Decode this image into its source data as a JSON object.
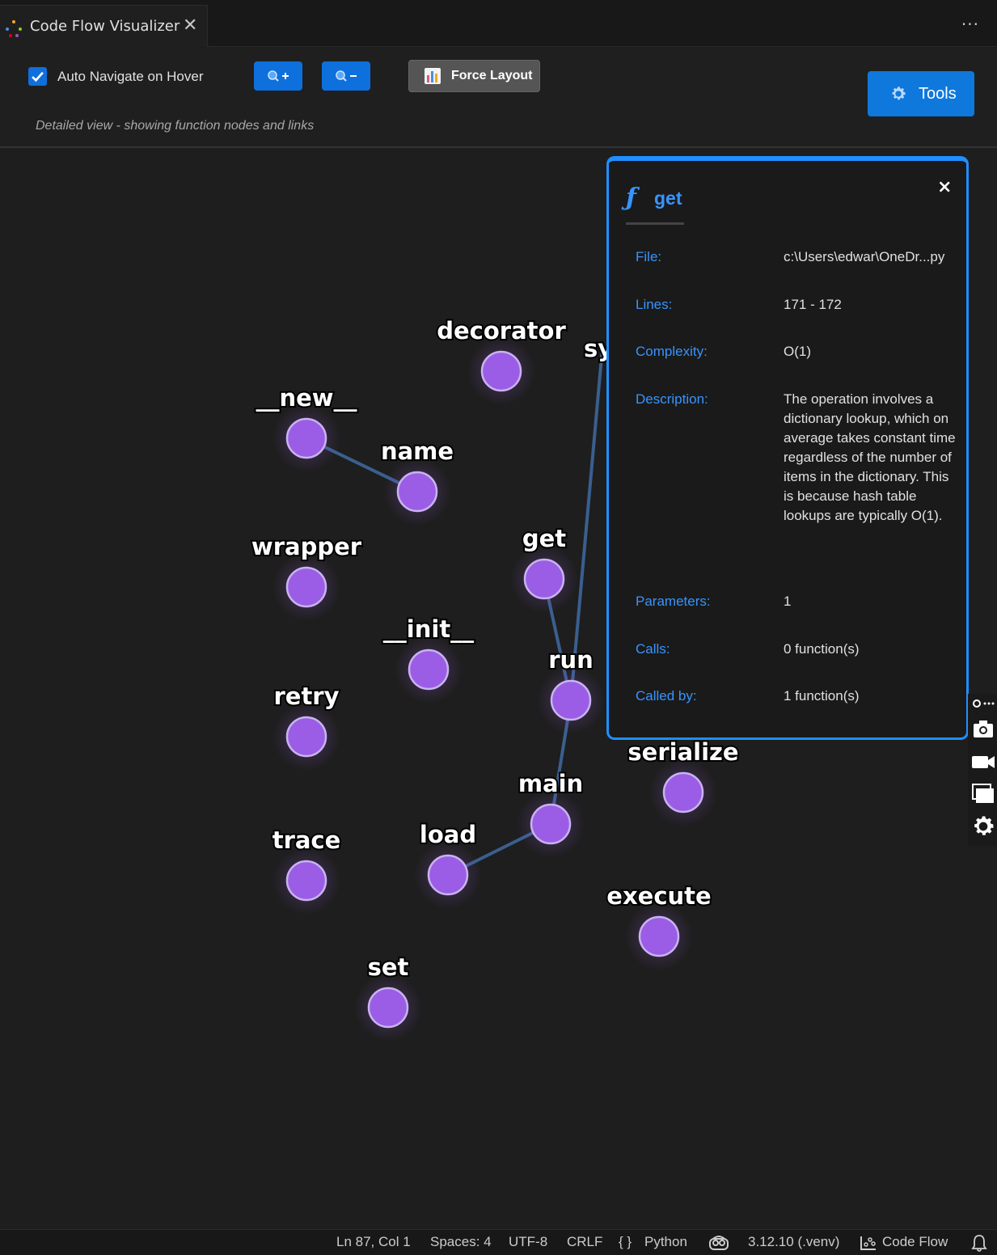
{
  "tab": {
    "title": "Code Flow Visualizer",
    "close_glyph": "✕",
    "more_glyph": "···"
  },
  "toolbar": {
    "auto_navigate_label": "Auto Navigate on Hover",
    "auto_navigate_checked": true,
    "zoom_in_label": "🔍+",
    "zoom_out_label": "🔍−",
    "force_layout_label": "Force Layout",
    "tools_label": "Tools",
    "subtitle": "Detailed view - showing function nodes and links"
  },
  "graph": {
    "nodes": [
      "decorator",
      "sy",
      "__new__",
      "name",
      "wrapper",
      "get",
      "__init__",
      "run",
      "retry",
      "serialize",
      "main",
      "trace",
      "load",
      "execute",
      "set"
    ],
    "links": [
      [
        "__new__",
        "name"
      ],
      [
        "get",
        "run"
      ],
      [
        "run",
        "main"
      ],
      [
        "main",
        "load"
      ],
      [
        "run",
        "sy"
      ]
    ],
    "node_color": "#9b5de5"
  },
  "panel": {
    "fn_glyph": "ƒ",
    "name": "get",
    "close_glyph": "×",
    "rows": [
      {
        "key": "File:",
        "value": "c:\\Users\\edwar\\OneDr...py"
      },
      {
        "key": "Lines:",
        "value": "171 - 172"
      },
      {
        "key": "Complexity:",
        "value": "O(1)"
      },
      {
        "key": "Description:",
        "value": "The operation involves a dictionary lookup, which on average takes constant time regardless of the number of items in the dictionary. This is because hash table lookups are typically O(1)."
      },
      {
        "key": "Parameters:",
        "value": "1"
      },
      {
        "key": "Calls:",
        "value": "0 function(s)"
      },
      {
        "key": "Called by:",
        "value": "1 function(s)"
      }
    ]
  },
  "status": {
    "position": "Ln 87, Col 1",
    "spaces": "Spaces: 4",
    "encoding": "UTF-8",
    "eol": "CRLF",
    "language_glyph": "{ }",
    "language": "Python",
    "interpreter": "3.12.10 (.venv)",
    "code_flow": "Code Flow"
  },
  "colors": {
    "accent": "#0e70dc",
    "panel_border": "#1f8fff",
    "link": "#3a5f8f"
  }
}
